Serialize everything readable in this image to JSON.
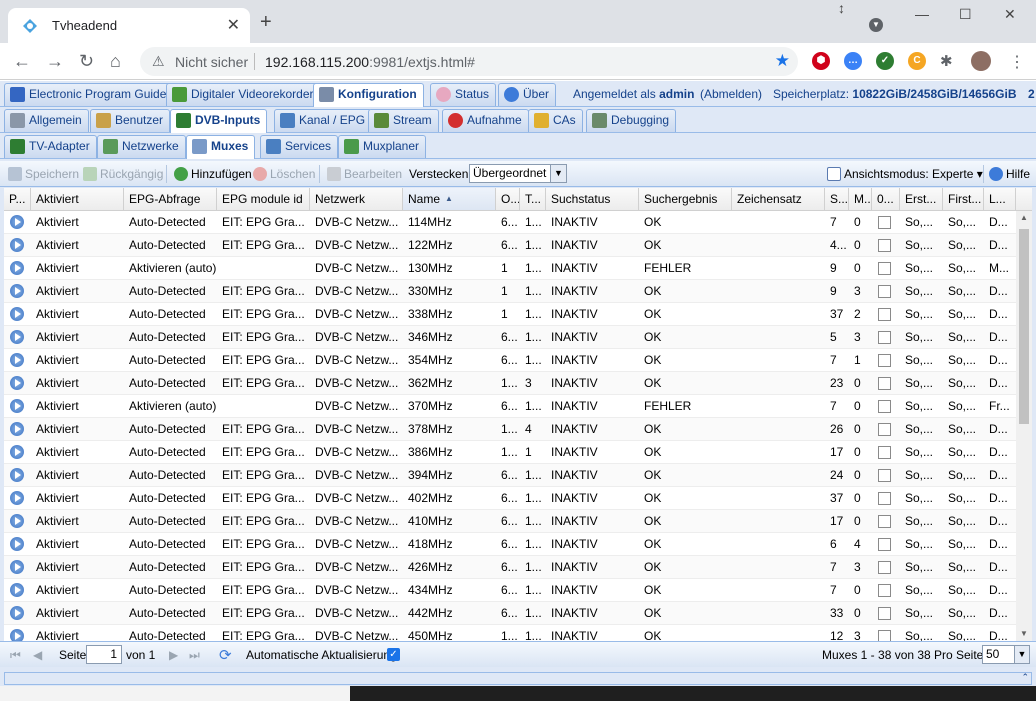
{
  "browser": {
    "tab_title": "Tvheadend",
    "security_label": "Nicht sicher",
    "url_host": "192.168.115.200",
    "url_rest": ":9981/extjs.html#"
  },
  "main_tabs": [
    {
      "label": "Electronic Program Guide",
      "icon": "epg-icon"
    },
    {
      "label": "Digitaler Videorekorder",
      "icon": "recorder-icon"
    },
    {
      "label": "Konfiguration",
      "icon": "wrench-icon",
      "active": true
    },
    {
      "label": "Status",
      "icon": "eye-icon"
    },
    {
      "label": "Über",
      "icon": "info-icon"
    }
  ],
  "header": {
    "logged_in_prefix": "Angemeldet als",
    "user": "admin",
    "logout": "(Abmelden)",
    "storage_label": "Speicherplatz:",
    "storage_value": "10822GiB/2458GiB/14656GiB",
    "storage_tail": "2"
  },
  "config_tabs": [
    {
      "label": "Allgemein"
    },
    {
      "label": "Benutzer"
    },
    {
      "label": "DVB-Inputs",
      "active": true
    },
    {
      "label": "Kanal / EPG"
    },
    {
      "label": "Stream"
    },
    {
      "label": "Aufnahme"
    },
    {
      "label": "CAs"
    },
    {
      "label": "Debugging"
    }
  ],
  "dvb_tabs": [
    {
      "label": "TV-Adapter"
    },
    {
      "label": "Netzwerke"
    },
    {
      "label": "Muxes",
      "active": true
    },
    {
      "label": "Services"
    },
    {
      "label": "Muxplaner"
    }
  ],
  "grid_toolbar": {
    "save": "Speichern",
    "undo": "Rückgängig",
    "add": "Hinzufügen",
    "delete": "Löschen",
    "edit": "Bearbeiten",
    "hide_label": "Verstecken:",
    "hide_value": "Übergeordnet d",
    "view_mode": "Ansichtsmodus: Experte",
    "help": "Hilfe"
  },
  "columns": [
    "P...",
    "Aktiviert",
    "EPG-Abfrage",
    "EPG module id",
    "Netzwerk",
    "Name",
    "O...",
    "T...",
    "Suchstatus",
    "Suchergebnis",
    "Zeichensatz",
    "S...",
    "M...",
    "0...",
    "Erst...",
    "First...",
    "L..."
  ],
  "sort_indicator": "▲",
  "rows": [
    [
      "Aktiviert",
      "Auto-Detected",
      "EIT: EPG Gra...",
      "DVB-C Netzw...",
      "114MHz",
      "6...",
      "1...",
      "INAKTIV",
      "OK",
      "",
      "7",
      "0",
      "So,...",
      "So,...",
      "D..."
    ],
    [
      "Aktiviert",
      "Auto-Detected",
      "EIT: EPG Gra...",
      "DVB-C Netzw...",
      "122MHz",
      "6...",
      "1...",
      "INAKTIV",
      "OK",
      "",
      "4...",
      "0",
      "So,...",
      "So,...",
      "D..."
    ],
    [
      "Aktiviert",
      "Aktivieren (auto)",
      "",
      "DVB-C Netzw...",
      "130MHz",
      "1",
      "1...",
      "INAKTIV",
      "FEHLER",
      "",
      "9",
      "0",
      "So,...",
      "So,...",
      "M..."
    ],
    [
      "Aktiviert",
      "Auto-Detected",
      "EIT: EPG Gra...",
      "DVB-C Netzw...",
      "330MHz",
      "1",
      "1...",
      "INAKTIV",
      "OK",
      "",
      "9",
      "3",
      "So,...",
      "So,...",
      "D..."
    ],
    [
      "Aktiviert",
      "Auto-Detected",
      "EIT: EPG Gra...",
      "DVB-C Netzw...",
      "338MHz",
      "1",
      "1...",
      "INAKTIV",
      "OK",
      "",
      "37",
      "2",
      "So,...",
      "So,...",
      "D..."
    ],
    [
      "Aktiviert",
      "Auto-Detected",
      "EIT: EPG Gra...",
      "DVB-C Netzw...",
      "346MHz",
      "6...",
      "1...",
      "INAKTIV",
      "OK",
      "",
      "5",
      "3",
      "So,...",
      "So,...",
      "D..."
    ],
    [
      "Aktiviert",
      "Auto-Detected",
      "EIT: EPG Gra...",
      "DVB-C Netzw...",
      "354MHz",
      "6...",
      "1...",
      "INAKTIV",
      "OK",
      "",
      "7",
      "1",
      "So,...",
      "So,...",
      "D..."
    ],
    [
      "Aktiviert",
      "Auto-Detected",
      "EIT: EPG Gra...",
      "DVB-C Netzw...",
      "362MHz",
      "1...",
      "3",
      "INAKTIV",
      "OK",
      "",
      "23",
      "0",
      "So,...",
      "So,...",
      "D..."
    ],
    [
      "Aktiviert",
      "Aktivieren (auto)",
      "",
      "DVB-C Netzw...",
      "370MHz",
      "6...",
      "1...",
      "INAKTIV",
      "FEHLER",
      "",
      "7",
      "0",
      "So,...",
      "So,...",
      "Fr..."
    ],
    [
      "Aktiviert",
      "Auto-Detected",
      "EIT: EPG Gra...",
      "DVB-C Netzw...",
      "378MHz",
      "1...",
      "4",
      "INAKTIV",
      "OK",
      "",
      "26",
      "0",
      "So,...",
      "So,...",
      "D..."
    ],
    [
      "Aktiviert",
      "Auto-Detected",
      "EIT: EPG Gra...",
      "DVB-C Netzw...",
      "386MHz",
      "1...",
      "1",
      "INAKTIV",
      "OK",
      "",
      "17",
      "0",
      "So,...",
      "So,...",
      "D..."
    ],
    [
      "Aktiviert",
      "Auto-Detected",
      "EIT: EPG Gra...",
      "DVB-C Netzw...",
      "394MHz",
      "6...",
      "1...",
      "INAKTIV",
      "OK",
      "",
      "24",
      "0",
      "So,...",
      "So,...",
      "D..."
    ],
    [
      "Aktiviert",
      "Auto-Detected",
      "EIT: EPG Gra...",
      "DVB-C Netzw...",
      "402MHz",
      "6...",
      "1...",
      "INAKTIV",
      "OK",
      "",
      "37",
      "0",
      "So,...",
      "So,...",
      "D..."
    ],
    [
      "Aktiviert",
      "Auto-Detected",
      "EIT: EPG Gra...",
      "DVB-C Netzw...",
      "410MHz",
      "6...",
      "1...",
      "INAKTIV",
      "OK",
      "",
      "17",
      "0",
      "So,...",
      "So,...",
      "D..."
    ],
    [
      "Aktiviert",
      "Auto-Detected",
      "EIT: EPG Gra...",
      "DVB-C Netzw...",
      "418MHz",
      "6...",
      "1...",
      "INAKTIV",
      "OK",
      "",
      "6",
      "4",
      "So,...",
      "So,...",
      "D..."
    ],
    [
      "Aktiviert",
      "Auto-Detected",
      "EIT: EPG Gra...",
      "DVB-C Netzw...",
      "426MHz",
      "6...",
      "1...",
      "INAKTIV",
      "OK",
      "",
      "7",
      "3",
      "So,...",
      "So,...",
      "D..."
    ],
    [
      "Aktiviert",
      "Auto-Detected",
      "EIT: EPG Gra...",
      "DVB-C Netzw...",
      "434MHz",
      "6...",
      "1...",
      "INAKTIV",
      "OK",
      "",
      "7",
      "0",
      "So,...",
      "So,...",
      "D..."
    ],
    [
      "Aktiviert",
      "Auto-Detected",
      "EIT: EPG Gra...",
      "DVB-C Netzw...",
      "442MHz",
      "6...",
      "1...",
      "INAKTIV",
      "OK",
      "",
      "33",
      "0",
      "So,...",
      "So,...",
      "D..."
    ],
    [
      "Aktiviert",
      "Auto-Detected",
      "EIT: EPG Gra...",
      "DVB-C Netzw...",
      "450MHz",
      "1...",
      "1...",
      "INAKTIV",
      "OK",
      "",
      "12",
      "3",
      "So,...",
      "So,...",
      "D..."
    ]
  ],
  "paging": {
    "page_label": "Seite",
    "page_value": "1",
    "of_label": "von 1",
    "auto_refresh": "Automatische Aktualisierung",
    "count": "Muxes 1 - 38 von 38",
    "per_page_label": "Pro Seite",
    "per_page_value": "50"
  },
  "colors": {
    "accent": "#15428b",
    "chrome_bg": "#dee1e6",
    "app_bg": "#dfe8f6"
  }
}
